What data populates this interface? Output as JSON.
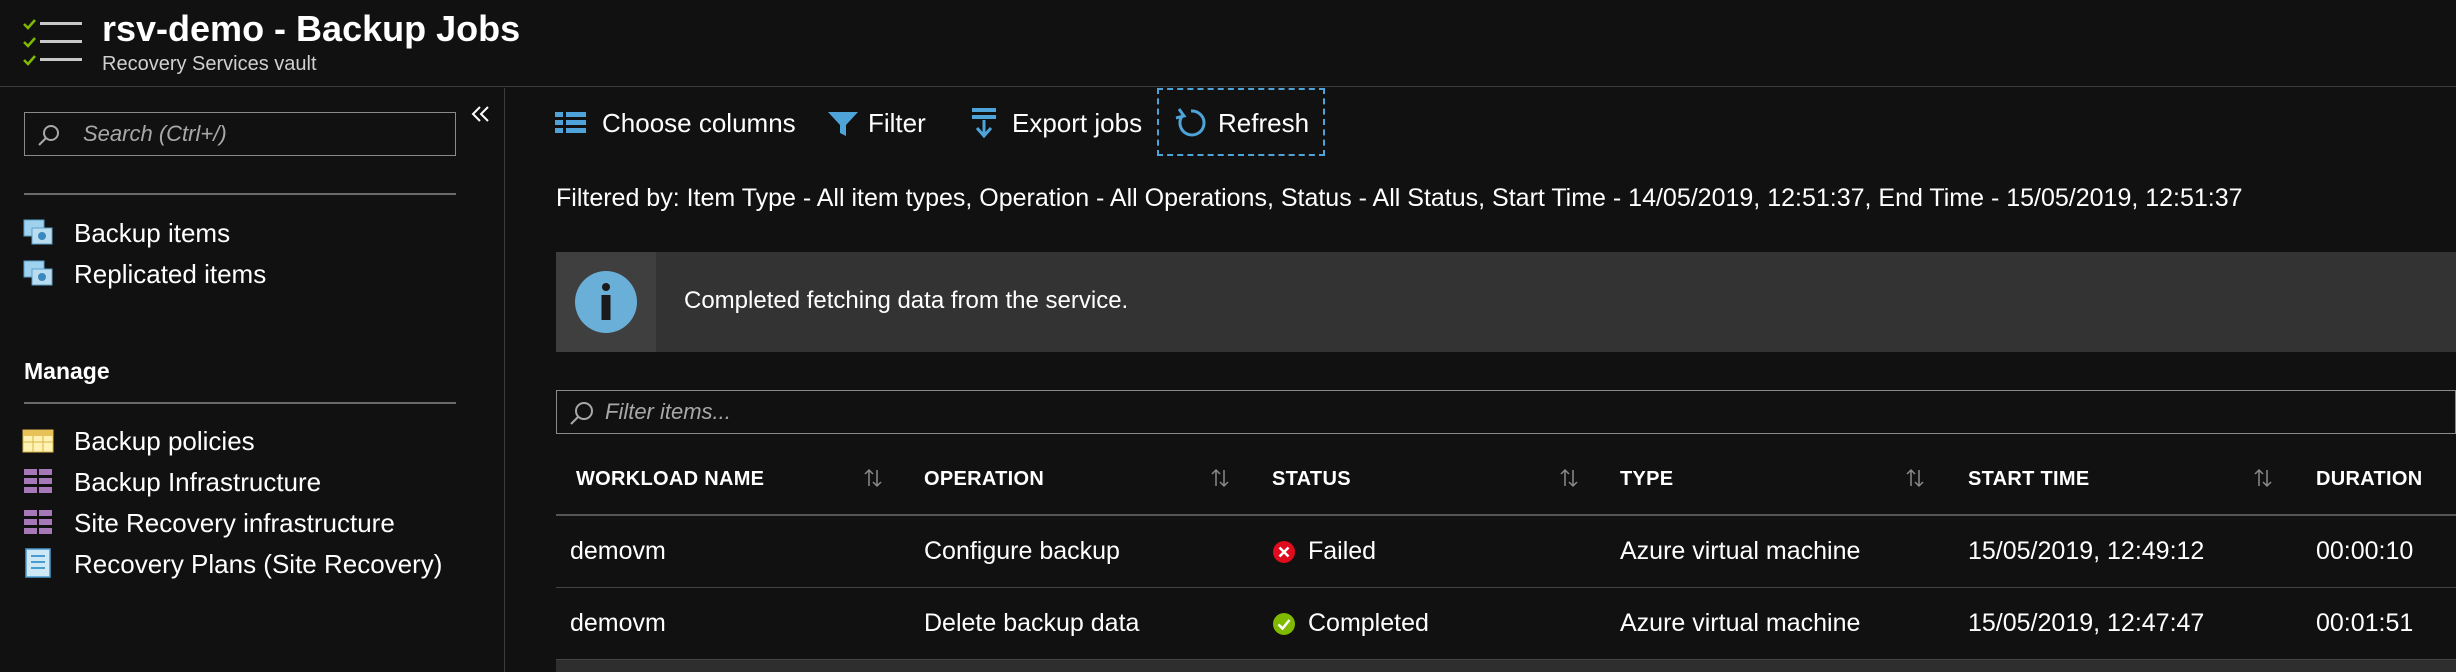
{
  "header": {
    "title": "rsv-demo - Backup Jobs",
    "subtitle": "Recovery Services vault",
    "icon": "backup-jobs-list-icon"
  },
  "sidebar": {
    "search_placeholder": "Search (Ctrl+/)",
    "collapse_icon": "double-chevron-left-icon",
    "items": [
      {
        "label": "Backup items",
        "icon": "backup-items-icon"
      },
      {
        "label": "Replicated items",
        "icon": "replicated-items-icon"
      }
    ],
    "manage_section": {
      "label": "Manage",
      "items": [
        {
          "label": "Backup policies",
          "icon": "backup-policies-icon"
        },
        {
          "label": "Backup Infrastructure",
          "icon": "backup-infrastructure-icon"
        },
        {
          "label": "Site Recovery infrastructure",
          "icon": "site-recovery-infrastructure-icon"
        },
        {
          "label": "Recovery Plans (Site Recovery)",
          "icon": "recovery-plans-icon"
        }
      ]
    }
  },
  "toolbar": {
    "choose_columns": "Choose columns",
    "filter": "Filter",
    "export_jobs": "Export jobs",
    "refresh": "Refresh"
  },
  "filter_summary": "Filtered by: Item Type - All item types, Operation - All Operations, Status - All Status, Start Time - 14/05/2019, 12:51:37, End Time - 15/05/2019, 12:51:37",
  "info_banner": {
    "icon": "info-icon",
    "message": "Completed fetching data from the service."
  },
  "filter_items_placeholder": "Filter items...",
  "grid": {
    "columns": [
      "WORKLOAD NAME",
      "OPERATION",
      "STATUS",
      "TYPE",
      "START TIME",
      "DURATION"
    ],
    "rows": [
      {
        "workload": "demovm",
        "operation": "Configure backup",
        "status": "Failed",
        "status_icon": "error-circle-icon",
        "type": "Azure virtual machine",
        "start_time": "15/05/2019, 12:49:12",
        "duration": "00:00:10"
      },
      {
        "workload": "demovm",
        "operation": "Delete backup data",
        "status": "Completed",
        "status_icon": "check-circle-icon",
        "type": "Azure virtual machine",
        "start_time": "15/05/2019, 12:47:47",
        "duration": "00:01:51"
      }
    ]
  },
  "colors": {
    "background": "#111111",
    "accent": "#4ea3d9",
    "info_blue": "#6aafd8",
    "failed_red": "#e00b1c",
    "completed_green": "#7fba00",
    "banner_gray": "#333333"
  }
}
